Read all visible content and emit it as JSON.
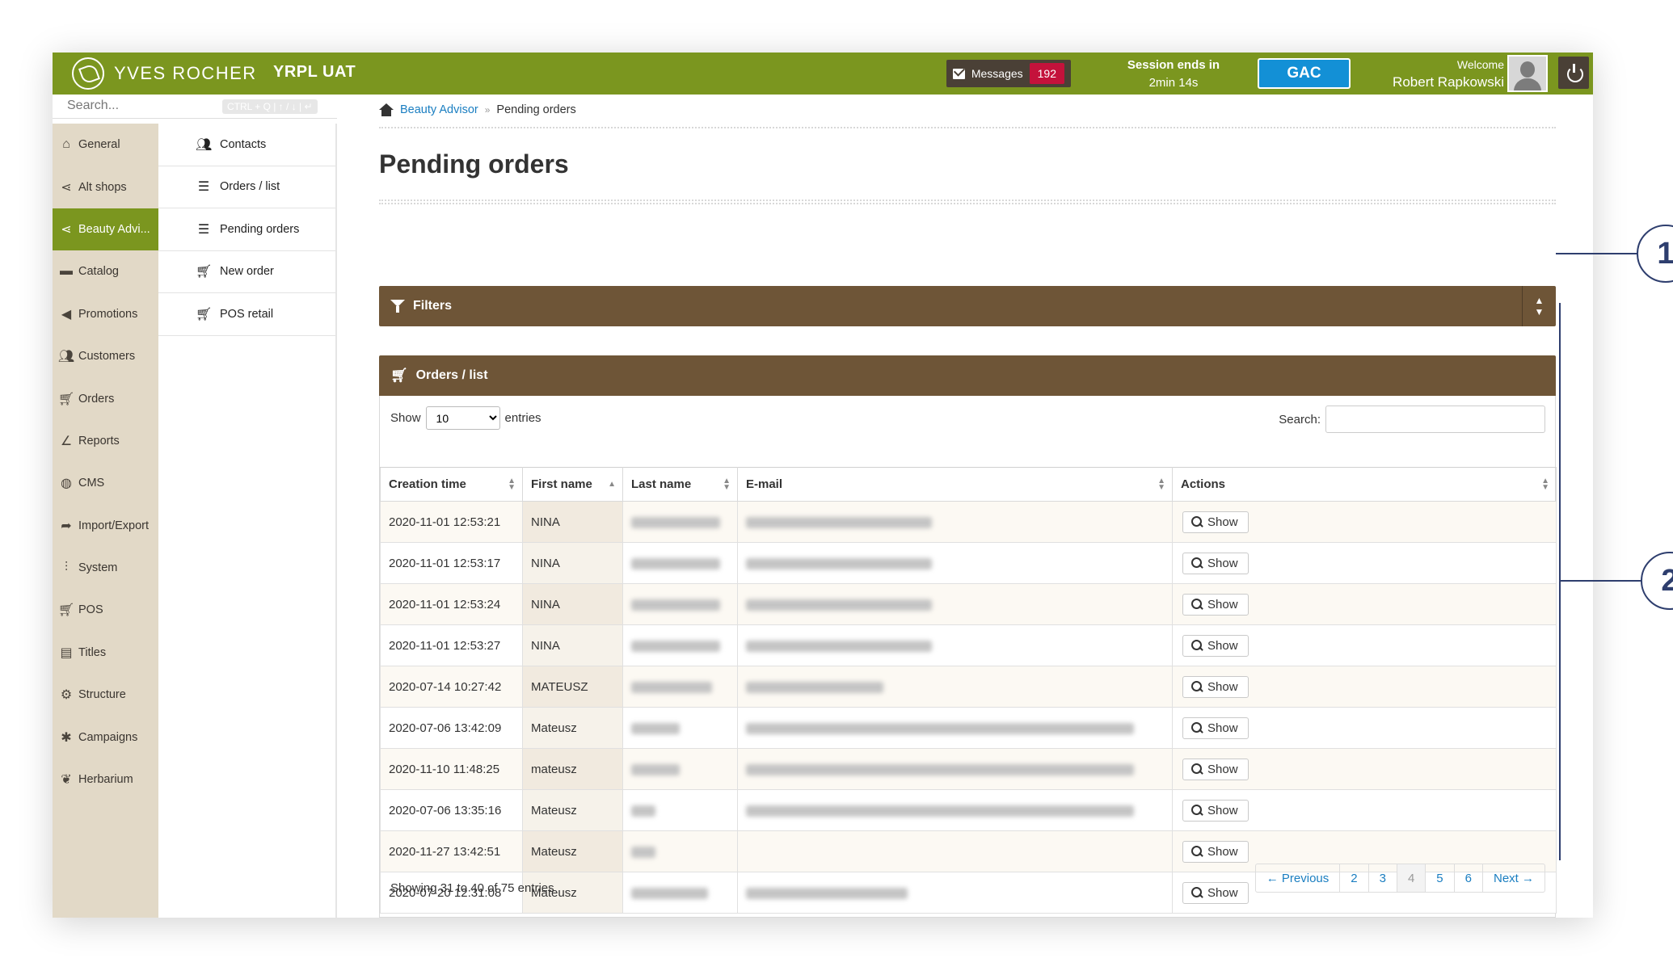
{
  "header": {
    "brand": "YVES ROCHER",
    "environment": "YRPL UAT",
    "messages_label": "Messages",
    "messages_count": "192",
    "session_line1": "Session ends in",
    "session_line2": "2min 14s",
    "gac_label": "GAC",
    "welcome_label": "Welcome",
    "user_name": "Robert Rapkowski",
    "brand_color": "#7b961f"
  },
  "search": {
    "placeholder": "Search...",
    "shortcut_hint": "CTRL + Q | ↑ / ↓ | ↵"
  },
  "sidebar": {
    "items": [
      {
        "label": "General",
        "icon": "home-icon"
      },
      {
        "label": "Alt shops",
        "icon": "share-icon"
      },
      {
        "label": "Beauty Advi...",
        "icon": "share-icon"
      },
      {
        "label": "Catalog",
        "icon": "folder-icon"
      },
      {
        "label": "Promotions",
        "icon": "megaphone-icon"
      },
      {
        "label": "Customers",
        "icon": "users-icon"
      },
      {
        "label": "Orders",
        "icon": "cart-icon"
      },
      {
        "label": "Reports",
        "icon": "chart-icon"
      },
      {
        "label": "CMS",
        "icon": "globe-icon"
      },
      {
        "label": "Import/Export",
        "icon": "arrow-share-icon"
      },
      {
        "label": "System",
        "icon": "sliders-icon"
      },
      {
        "label": "POS",
        "icon": "cart-icon"
      },
      {
        "label": "Titles",
        "icon": "list-card-icon"
      },
      {
        "label": "Structure",
        "icon": "gear-icon"
      },
      {
        "label": "Campaigns",
        "icon": "asterisk-icon"
      },
      {
        "label": "Herbarium",
        "icon": "leaf-icon"
      }
    ]
  },
  "submenu": {
    "items": [
      {
        "label": "Contacts",
        "icon": "users-icon"
      },
      {
        "label": "Orders / list",
        "icon": "list-icon"
      },
      {
        "label": "Pending orders",
        "icon": "list-icon"
      },
      {
        "label": "New order",
        "icon": "cart-icon"
      },
      {
        "label": "POS retail",
        "icon": "cart-icon"
      }
    ]
  },
  "breadcrumb": {
    "link": "Beauty Advisor",
    "separator": "»",
    "current": "Pending orders"
  },
  "page": {
    "title": "Pending orders"
  },
  "filters": {
    "title": "Filters"
  },
  "orders": {
    "title": "Orders / list",
    "show_label": "Show",
    "entries_label": "entries",
    "page_size": "10",
    "search_label": "Search:",
    "columns": [
      "Creation time",
      "First name",
      "Last name",
      "E-mail",
      "Actions"
    ],
    "rows": [
      {
        "time": "2020-11-01 12:53:21",
        "first": "NINA"
      },
      {
        "time": "2020-11-01 12:53:17",
        "first": "NINA"
      },
      {
        "time": "2020-11-01 12:53:24",
        "first": "NINA"
      },
      {
        "time": "2020-11-01 12:53:27",
        "first": "NINA"
      },
      {
        "time": "2020-07-14 10:27:42",
        "first": "MATEUSZ"
      },
      {
        "time": "2020-07-06 13:42:09",
        "first": "Mateusz"
      },
      {
        "time": "2020-11-10 11:48:25",
        "first": "mateusz"
      },
      {
        "time": "2020-07-06 13:35:16",
        "first": "Mateusz"
      },
      {
        "time": "2020-11-27 13:42:51",
        "first": "Mateusz"
      },
      {
        "time": "2020-07-20 12:31:08",
        "first": "Mateusz"
      }
    ],
    "show_button": "Show",
    "info": "Showing 31 to 40 of 75 entries",
    "pagination": [
      "← Previous",
      "2",
      "3",
      "4",
      "5",
      "6",
      "Next →"
    ],
    "current_page": "4"
  },
  "callouts": [
    "1",
    "2"
  ]
}
